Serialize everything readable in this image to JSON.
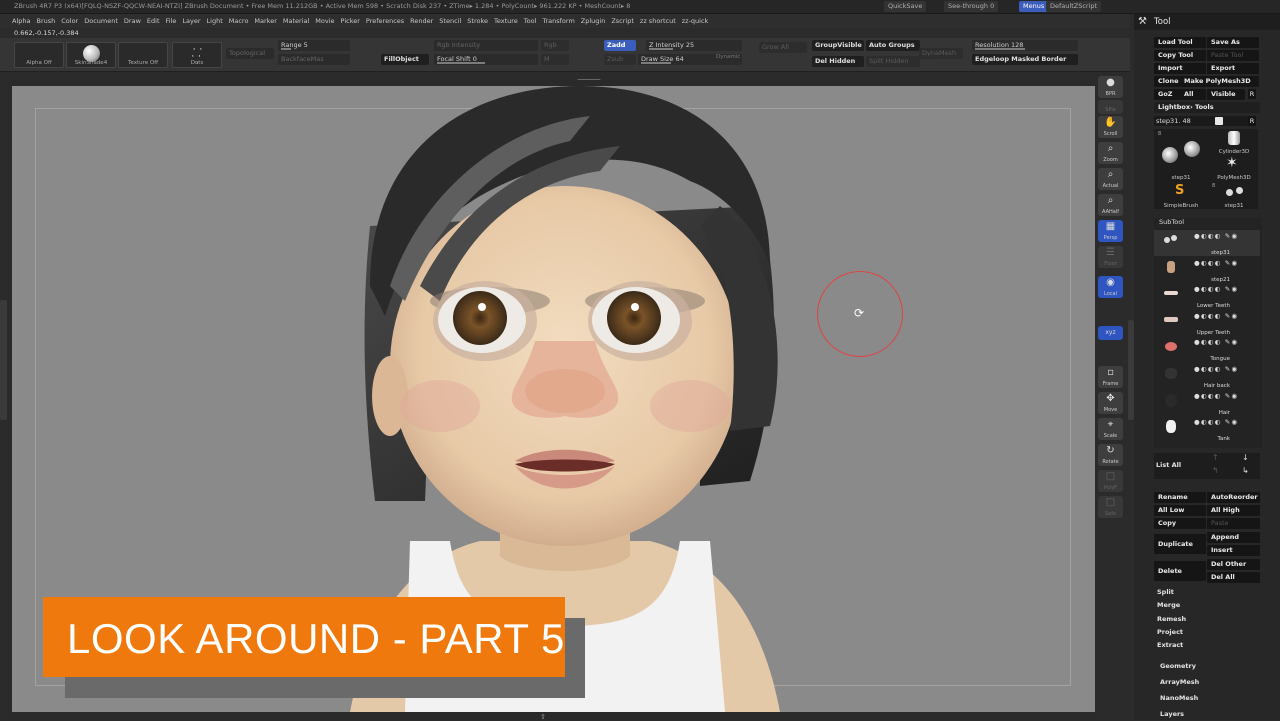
{
  "topbar": {
    "info": "ZBrush 4R7 P3 (x64)[FQLQ-NSZF-QQCW-NEAI-NTZI]   ZBrush Document   • Free Mem 11.212GB • Active Mem 598 • Scratch Disk 237 • ZTime▸ 1.284 • PolyCount▸ 961.222 KP • MeshCount▸ 8",
    "quicksave": "QuickSave",
    "see_through": "See-through 0",
    "menus": "Menus",
    "default_zscript": "DefaultZScript"
  },
  "menubar": [
    "Alpha",
    "Brush",
    "Color",
    "Document",
    "Draw",
    "Edit",
    "File",
    "Layer",
    "Light",
    "Macro",
    "Marker",
    "Material",
    "Movie",
    "Picker",
    "Preferences",
    "Render",
    "Stencil",
    "Stroke",
    "Texture",
    "Tool",
    "Transform",
    "Zplugin",
    "Zscript",
    "zz shortcut",
    "zz-quick"
  ],
  "coords": "0.662,-0.157,-0.384",
  "shelf": {
    "alpha": "Alpha Off",
    "material": "SkinShade4",
    "texture": "Texture Off",
    "stroke": "Dots",
    "topological": "Topological",
    "range": "Range 5",
    "backfacemask": "BackfaceMas",
    "fillobject": "FillObject",
    "rgb_intensity": "Rgb Intensity",
    "focal_shift": "Focal Shift 0",
    "rgb": "Rgb",
    "m": "M",
    "zadd": "Zadd",
    "zsub": "Zsub",
    "z_intensity": "Z Intensity 25",
    "draw_size": "Draw Size 64",
    "dynamic": "Dynamic",
    "grow_all": "Grow All",
    "group_visible": "GroupVisible",
    "auto_groups": "Auto Groups",
    "del_hidden": "Del Hidden",
    "split_hidden": "Split Hidden",
    "dynamesh": "DynaMesh",
    "resolution": "Resolution 128",
    "edgeloop": "Edgeloop Masked Border"
  },
  "rightshelf": [
    {
      "icon": "●",
      "label": "BPR"
    },
    {
      "icon": "≡",
      "label": "SPix"
    },
    {
      "icon": "✋",
      "label": "Scroll"
    },
    {
      "icon": "⌕",
      "label": "Zoom"
    },
    {
      "icon": "⌕",
      "label": "Actual"
    },
    {
      "icon": "⌕",
      "label": "AAHalf"
    },
    {
      "icon": "▦",
      "label": "Persp"
    },
    {
      "icon": "☰",
      "label": "Floor"
    },
    {
      "icon": "◉",
      "label": "Local"
    },
    {
      "icon": "xyz",
      "label": "Gizmo"
    },
    {
      "icon": "▫",
      "label": "Frame"
    },
    {
      "icon": "✥",
      "label": "Move"
    },
    {
      "icon": "⌖",
      "label": "Scale"
    },
    {
      "icon": "↻",
      "label": "Rotate"
    },
    {
      "icon": "□",
      "label": "PolyF"
    },
    {
      "icon": "□",
      "label": "Solo"
    }
  ],
  "panel": {
    "title": "Tool",
    "load_tool": "Load Tool",
    "save_as": "Save As",
    "copy_tool": "Copy Tool",
    "paste_tool": "Paste Tool",
    "import": "Import",
    "export": "Export",
    "clone": "Clone",
    "make_polymesh": "Make PolyMesh3D",
    "goz": "GoZ",
    "all": "All",
    "visible": "Visible",
    "r": "R",
    "lightbox": "Lightbox› Tools",
    "step_slider": "step31. 48",
    "tools": [
      {
        "name": "step31",
        "count": "8"
      },
      {
        "name": "Cylinder3D",
        "count": ""
      },
      {
        "name": "PolyMesh3D",
        "count": ""
      },
      {
        "name": "SimpleBrush",
        "count": ""
      },
      {
        "name": "step31",
        "count": "8"
      }
    ],
    "subtool_title": "SubTool",
    "subtools": [
      "step31",
      "step21",
      "Lower Teeth",
      "Upper Teeth",
      "Tongue",
      "Hair back",
      "Hair",
      "Tank"
    ],
    "list_all": "List All",
    "rename": "Rename",
    "autoreorder": "AutoReorder",
    "all_low": "All Low",
    "all_high": "All High",
    "copy": "Copy",
    "paste": "Paste",
    "duplicate": "Duplicate",
    "append": "Append",
    "insert": "Insert",
    "delete": "Delete",
    "del_other": "Del Other",
    "del_all": "Del All",
    "split": "Split",
    "merge": "Merge",
    "remesh": "Remesh",
    "project": "Project",
    "extract": "Extract",
    "geometry": "Geometry",
    "arraymesh": "ArrayMesh",
    "nanomesh": "NanoMesh",
    "layers": "Layers"
  },
  "overlay_title": "LOOK AROUND - PART 5",
  "colors": {
    "accent": "#f0790e",
    "ui_blue": "#3b5dbb",
    "canvas": "#8a8a8a"
  }
}
